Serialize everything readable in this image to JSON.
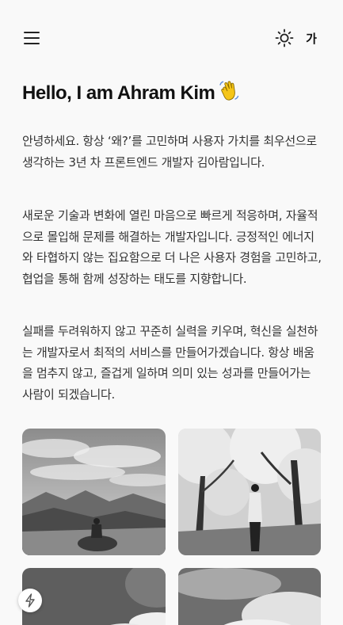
{
  "header": {
    "menu_icon": "hamburger-menu-icon",
    "theme_icon": "sun-icon",
    "lang_label": "가"
  },
  "hero": {
    "title": "Hello, I am Ahram Kim",
    "emoji": "waving-hand-icon"
  },
  "intro": {
    "paragraphs": [
      "안녕하세요. 항상 ‘왜?’를 고민하며 사용자 가치를 최우선으로 생각하는 3년 차 프론트엔드 개발자 김아람입니다.",
      "새로운 기술과 변화에 열린 마음으로 빠르게 적응하며, 자율적으로 몰입해 문제를 해결하는 개발자입니다. 긍정적인 에너지와 타협하지 않는 집요함으로 더 나은 사용자 경험을 고민하고, 협업을 통해 함께 성장하는 태도를 지향합니다.",
      "실패를 두려워하지 않고 꾸준히 실력을 키우며, 혁신을 실천하는 개발자로서 최적의 서비스를 만들어가겠습니다. 항상 배움을 멈추지 않고, 즐겁게 일하며 의미 있는 성과를 만들어가는 사람이 되겠습니다."
    ]
  },
  "gallery": {
    "photos": [
      "mountain-landscape-photo",
      "cherry-blossom-trees-photo",
      "clouds-sky-photo",
      "clouds-sky-photo"
    ]
  },
  "floating_button": {
    "icon": "lightning-bolt-icon"
  }
}
